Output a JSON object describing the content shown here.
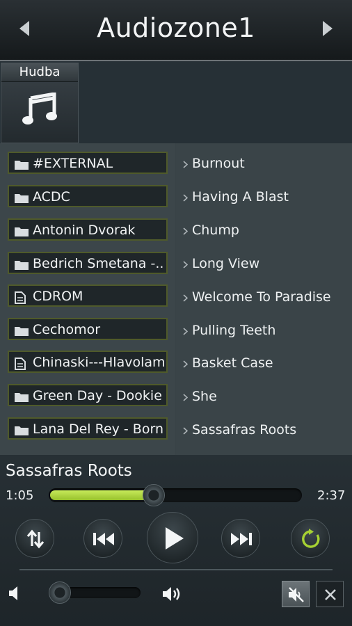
{
  "header": {
    "title": "Audiozone1"
  },
  "category": {
    "label": "Hudba"
  },
  "folders": [
    {
      "name": "#EXTERNAL",
      "icon": "folder-icon"
    },
    {
      "name": "ACDC",
      "icon": "folder-icon"
    },
    {
      "name": "Antonin Dvorak",
      "icon": "folder-icon"
    },
    {
      "name": "Bedrich Smetana -...",
      "icon": "folder-icon"
    },
    {
      "name": "CDROM",
      "icon": "file-icon"
    },
    {
      "name": "Cechomor",
      "icon": "folder-icon"
    },
    {
      "name": "Chinaski---Hlavolam...",
      "icon": "file-icon"
    },
    {
      "name": "Green Day - Dookie",
      "icon": "folder-icon"
    },
    {
      "name": "Lana Del Rey - Born...",
      "icon": "folder-icon"
    }
  ],
  "tracks": [
    "Burnout",
    "Having A Blast",
    "Chump",
    "Long View",
    "Welcome To Paradise",
    "Pulling Teeth",
    "Basket Case",
    "She",
    "Sassafras Roots"
  ],
  "player": {
    "now_playing": "Sassafras Roots",
    "current_time": "1:05",
    "total_time": "2:37",
    "progress": 0.413,
    "volume": 0.05,
    "accent_color": "#a6d133"
  }
}
